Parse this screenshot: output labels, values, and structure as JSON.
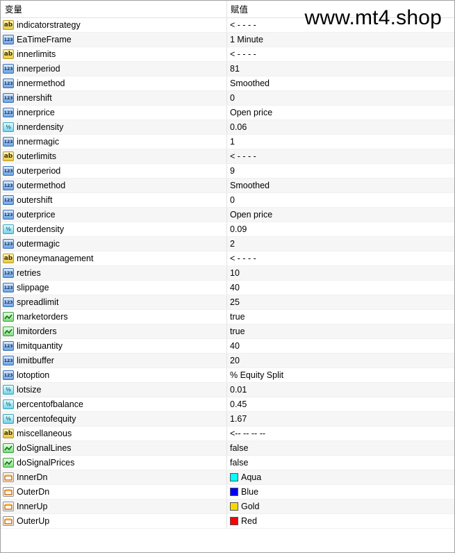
{
  "header": {
    "name_col": "变量",
    "value_col": "赋值"
  },
  "watermark": "www.mt4.shop",
  "rows": [
    {
      "icon": "ab",
      "name": "indicatorstrategy",
      "value": "< - - - -"
    },
    {
      "icon": "int",
      "name": "EaTimeFrame",
      "value": "1 Minute"
    },
    {
      "icon": "ab",
      "name": "innerlimits",
      "value": "< - - - -"
    },
    {
      "icon": "int",
      "name": "innerperiod",
      "value": "81"
    },
    {
      "icon": "int",
      "name": "innermethod",
      "value": "Smoothed"
    },
    {
      "icon": "int",
      "name": "innershift",
      "value": "0"
    },
    {
      "icon": "int",
      "name": "innerprice",
      "value": "Open price"
    },
    {
      "icon": "dbl",
      "name": "innerdensity",
      "value": "0.06"
    },
    {
      "icon": "int",
      "name": "innermagic",
      "value": "1"
    },
    {
      "icon": "ab",
      "name": "outerlimits",
      "value": "< - - - -"
    },
    {
      "icon": "int",
      "name": "outerperiod",
      "value": "9"
    },
    {
      "icon": "int",
      "name": "outermethod",
      "value": "Smoothed"
    },
    {
      "icon": "int",
      "name": "outershift",
      "value": "0"
    },
    {
      "icon": "int",
      "name": "outerprice",
      "value": "Open price"
    },
    {
      "icon": "dbl",
      "name": "outerdensity",
      "value": "0.09"
    },
    {
      "icon": "int",
      "name": "outermagic",
      "value": "2"
    },
    {
      "icon": "ab",
      "name": "moneymanagement",
      "value": "< - - - -"
    },
    {
      "icon": "int",
      "name": "retries",
      "value": "10"
    },
    {
      "icon": "int",
      "name": "slippage",
      "value": "40"
    },
    {
      "icon": "int",
      "name": "spreadlimit",
      "value": "25"
    },
    {
      "icon": "bool",
      "name": "marketorders",
      "value": "true"
    },
    {
      "icon": "bool",
      "name": "limitorders",
      "value": "true"
    },
    {
      "icon": "int",
      "name": "limitquantity",
      "value": "40"
    },
    {
      "icon": "int",
      "name": "limitbuffer",
      "value": "20"
    },
    {
      "icon": "int",
      "name": "lotoption",
      "value": "% Equity Split"
    },
    {
      "icon": "dbl",
      "name": "lotsize",
      "value": "0.01"
    },
    {
      "icon": "dbl",
      "name": "percentofbalance",
      "value": "0.45"
    },
    {
      "icon": "dbl",
      "name": "percentofequity",
      "value": "1.67"
    },
    {
      "icon": "ab",
      "name": "miscellaneous",
      "value": "<-- -- -- --"
    },
    {
      "icon": "bool",
      "name": "doSignalLines",
      "value": "false"
    },
    {
      "icon": "bool",
      "name": "doSignalPrices",
      "value": "false"
    },
    {
      "icon": "color",
      "name": "InnerDn",
      "value": "Aqua",
      "swatch": "#00ffff"
    },
    {
      "icon": "color",
      "name": "OuterDn",
      "value": "Blue",
      "swatch": "#0000ff"
    },
    {
      "icon": "color",
      "name": "InnerUp",
      "value": "Gold",
      "swatch": "#ffd700"
    },
    {
      "icon": "color",
      "name": "OuterUp",
      "value": "Red",
      "swatch": "#ff0000"
    }
  ]
}
